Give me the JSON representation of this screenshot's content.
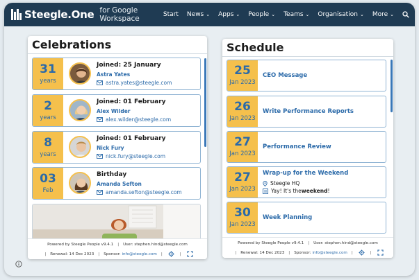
{
  "header": {
    "brand_name": "Steegle.One",
    "brand_sub": "for Google Workspace",
    "nav": [
      {
        "label": "Start",
        "has_menu": false
      },
      {
        "label": "News",
        "has_menu": true
      },
      {
        "label": "Apps",
        "has_menu": true
      },
      {
        "label": "People",
        "has_menu": true
      },
      {
        "label": "Teams",
        "has_menu": true
      },
      {
        "label": "Organisation",
        "has_menu": true
      },
      {
        "label": "More",
        "has_menu": true
      }
    ],
    "search_icon": "search-icon"
  },
  "celebrations": {
    "title": "Celebrations",
    "cards": [
      {
        "num": "31",
        "unit": "years",
        "title": "Joined: 25 January",
        "name": "Astra Yates",
        "email": "astra.yates@steegle.com"
      },
      {
        "num": "2",
        "unit": "years",
        "title": "Joined: 01 February",
        "name": "Alex Wilder",
        "email": "alex.wilder@steegle.com"
      },
      {
        "num": "8",
        "unit": "years",
        "title": "Joined: 01 February",
        "name": "Nick Fury",
        "email": "nick.fury@steegle.com"
      },
      {
        "num": "03",
        "unit": "Feb",
        "title": "Birthday",
        "name": "Amanda Sefton",
        "email": "amanda.sefton@steegle.com"
      }
    ],
    "footer": {
      "powered": "Powered by Steegle People v9.4.1",
      "user": "User: stephen.hind@steegle.com",
      "renewal": "Renewal: 14 Dec 2023",
      "sponsor_label": "Sponsor:",
      "sponsor_email": "info@steegle.com"
    }
  },
  "schedule": {
    "title": "Schedule",
    "events": [
      {
        "day": "25",
        "month": "Jan 2023",
        "title": "CEO Message"
      },
      {
        "day": "26",
        "month": "Jan 2023",
        "title": "Write Performance Reports"
      },
      {
        "day": "27",
        "month": "Jan 2023",
        "title": "Performance Review"
      },
      {
        "day": "27",
        "month": "Jan 2023",
        "title": "Wrap-up for the Weekend",
        "location": "Steegle HQ",
        "note_prefix": "Yay! It's the ",
        "note_bold": "weekend",
        "note_suffix": "!"
      },
      {
        "day": "30",
        "month": "Jan 2023",
        "title": "Week Planning"
      }
    ],
    "footer": {
      "powered": "Powered by Steegle People v9.4.1",
      "user": "User: stephen.hind@steegle.com",
      "renewal": "Renewal: 14 Dec 2023",
      "sponsor_label": "Sponsor:",
      "sponsor_email": "info@steegle.com"
    }
  },
  "colors": {
    "header_bg": "#1f3b53",
    "accent_yellow": "#f5c04c",
    "link_blue": "#2b6aa9"
  }
}
